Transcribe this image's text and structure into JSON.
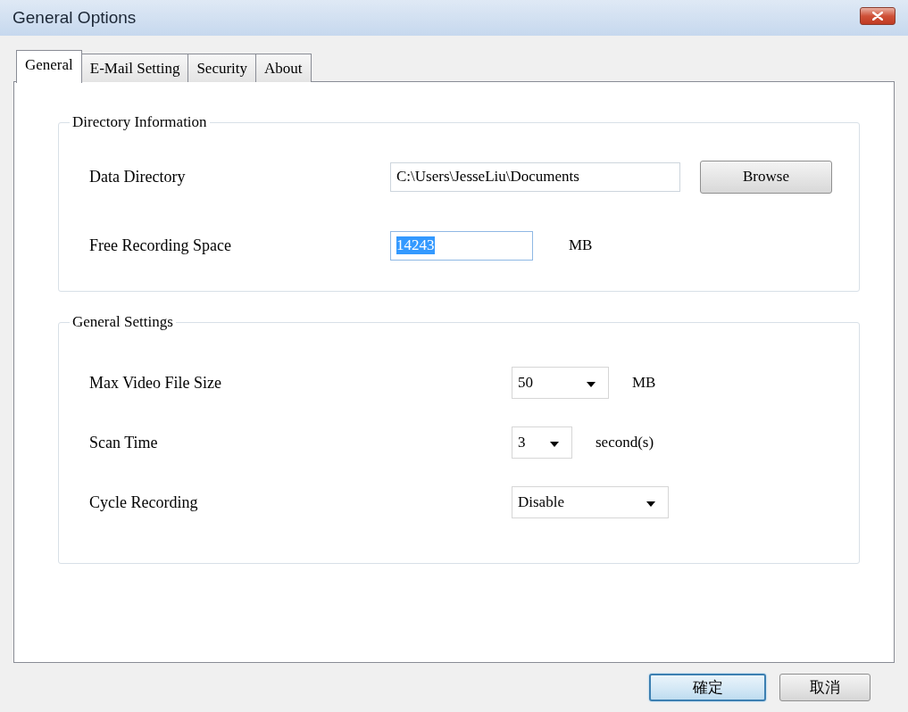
{
  "window": {
    "title": "General Options"
  },
  "tabs": [
    {
      "label": "General",
      "selected": true
    },
    {
      "label": "E-Mail Setting",
      "selected": false
    },
    {
      "label": "Security",
      "selected": false
    },
    {
      "label": "About",
      "selected": false
    }
  ],
  "groups": [
    {
      "title": "Directory Information",
      "rows": [
        {
          "kind": "text_field",
          "label": "Data Directory",
          "value": "C:\\Users\\JesseLiu\\Documents",
          "text_selected": false,
          "button": "Browse"
        },
        {
          "kind": "text_field",
          "label": "Free Recording Space",
          "value": "14243",
          "text_selected": true,
          "unit": "MB"
        }
      ]
    },
    {
      "title": "General Settings",
      "rows": [
        {
          "kind": "dropdown",
          "label": "Max Video File Size",
          "value": "50",
          "unit": "MB"
        },
        {
          "kind": "dropdown",
          "label": "Scan Time",
          "value": "3",
          "unit": "second(s)"
        },
        {
          "kind": "dropdown",
          "label": "Cycle Recording",
          "value": "Disable"
        }
      ]
    }
  ],
  "buttons": [
    {
      "label": "確定",
      "default": true
    },
    {
      "label": "取消",
      "default": false
    }
  ]
}
